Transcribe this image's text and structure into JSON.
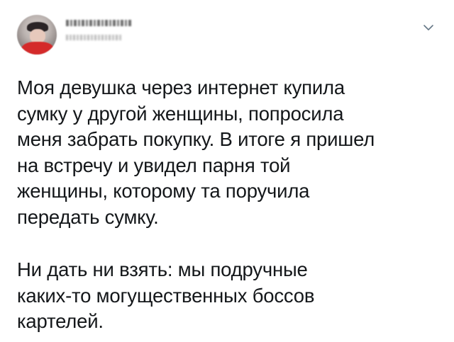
{
  "tweet": {
    "author": {
      "avatar_icon": "user-avatar-icon",
      "name": "",
      "handle": ""
    },
    "menu_icon": "chevron-down-icon",
    "paragraph_1": "Моя девушка через интернет купила\nсумку у другой женщины, попросила\nменя забрать покупку. В итоге я пришел\nна встречу и увидел парня той\nженщины, которому та поручила\nпередать сумку.",
    "paragraph_2": "Ни дать ни взять: мы подручные\nкаких-то могущественных боссов\nкартелей."
  },
  "colors": {
    "text": "#14171a",
    "background": "#ffffff",
    "chevron": "#657786"
  }
}
